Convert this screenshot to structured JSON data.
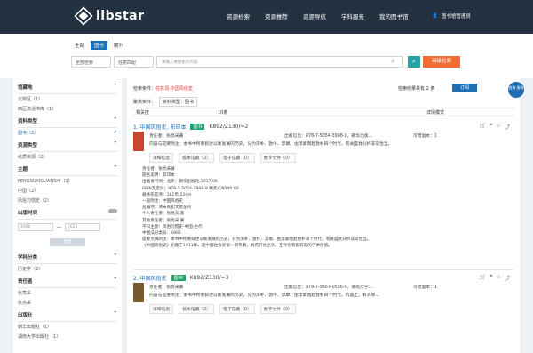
{
  "header": {
    "brand": "libstar",
    "nav": [
      "资源检索",
      "资源推荐",
      "资源导航",
      "学科服务",
      "我的图书馆"
    ],
    "user": "图书馆管理员",
    "colors": {
      "bg": "#23303f",
      "accent": "#1f6fb5"
    }
  },
  "tabs": [
    "全部",
    "图书",
    "期刊"
  ],
  "search": {
    "scope": "全部检索",
    "match": "任意匹配",
    "placeholder": "请输入要搜索的内容",
    "adv": "高级检索"
  },
  "left": {
    "sections": [
      {
        "title": "馆藏地",
        "items": [
          "北校区（1）",
          "西区流通书库（1）"
        ]
      },
      {
        "title": "资料类型",
        "items": [
          "图书（2）"
        ]
      },
      {
        "title": "资源类型",
        "items": [
          "纸质资源（2）"
        ]
      },
      {
        "title": "主题",
        "items": [
          "FENGSUXIGUANSHI（2）",
          "中国（2）",
          "风俗习惯史（2）"
        ]
      }
    ],
    "year_title": "出版时间",
    "year_from": "1900",
    "year_to": "2021",
    "year_ok": "确定",
    "sections2": [
      {
        "title": "学科分类",
        "items": [
          "历史学（2）"
        ]
      },
      {
        "title": "责任者",
        "items": [
          "张亮采",
          "张亮采"
        ]
      },
      {
        "title": "出版社",
        "items": [
          "朝华出版社（1）",
          "湖南大学出版社（1）"
        ]
      }
    ]
  },
  "main": {
    "crumb_label": "检索条件：",
    "crumb_val": "任意词-中国风俗史",
    "count": "检索结果共有 2 条",
    "subscribe": "订阅",
    "filter_label": "聚类条件：",
    "filter_chip": "资料类型：图书",
    "sort": "相关度",
    "per": "10条",
    "mode": "详情模式",
    "records": [
      {
        "title": "1. 中国风俗史. 影印本",
        "badge": "图书",
        "call": "K892/Z130/=2",
        "author": "责任者：张亮采著",
        "pub": "出版信息：978-7-5054-3998-9，朝华出版...",
        "copies": "可借复本：1",
        "abs": "内容与提要附注：本书中所要叙述以衡发展的历史，分为浑朴、敦朴、浮靡、由浮靡而趋敦朴四个时代，有关盛衰分析非常恰当。",
        "acts": [
          "详细信息",
          "纸本馆藏（2）",
          "电子馆藏（0）",
          "数字文件（0）"
        ],
        "details": [
          "责任者：张亮采著",
          "题名说明：影印本",
          "出版发行项：北京：朝华出版社,2017.08",
          "ISBN及定价：978-7-5054-3998-9 精装/CNY40.00",
          "载体形态项：182页;22cm",
          "一般附注：中国风俗史",
          "丛编项：清末民初文献丛刊",
          "个人责任者：张亮采,著",
          "其他责任者：张亮采,著",
          "学科主题：风俗习惯史-中国-古代",
          "中图法分类号：K892",
          "提要文摘附注：本书中所要叙述以衡发展的历史，分为浑朴、敦朴、浮靡、由浮靡而趋敦朴四个时代，有关盛衰分析非常恰当。",
          "《中国风俗史》初版于1911年，是中国社会史第一部专著，具有开创之功。至今仍有着较高的学术价值。"
        ]
      },
      {
        "title": "2. 中国风俗史",
        "badge": "图书",
        "call": "K892/Z130/=3",
        "author": "责任者：张亮采著",
        "pub": "出版信息：978-7-5667-0556-9，湖南大学...",
        "copies": "可借复本：1",
        "abs": "内容与提要附注：本书中所要叙述以衡发展的历史，分为浑朴、敦朴、浮靡、由浮靡而趋敦朴四个时代。内容上，有浓厚...",
        "acts": [
          "详细信息",
          "纸本馆藏（2）",
          "电子馆藏（0）",
          "数字文件（0）"
        ]
      }
    ]
  },
  "float": "咨询\n服务"
}
